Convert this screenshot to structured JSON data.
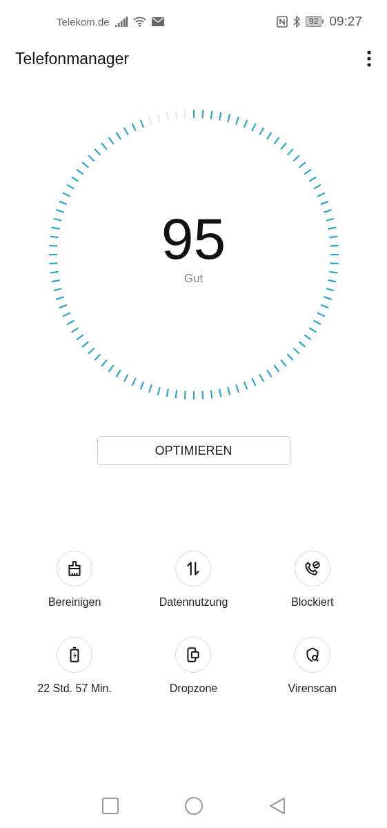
{
  "status_bar": {
    "carrier": "Telekom.de",
    "battery": "92",
    "time": "09:27"
  },
  "app_bar": {
    "title": "Telefonmanager"
  },
  "score": {
    "value": "95",
    "rating": "Gut"
  },
  "optimize_button": {
    "label": "OPTIMIEREN"
  },
  "tools": [
    {
      "kind": "clean",
      "label": "Bereinigen"
    },
    {
      "kind": "data",
      "label": "Datennutzung"
    },
    {
      "kind": "blocked",
      "label": "Blockiert"
    },
    {
      "kind": "battery",
      "label": "22 Std. 57 Min."
    },
    {
      "kind": "dropzone",
      "label": "Dropzone"
    },
    {
      "kind": "virus",
      "label": "Virenscan"
    }
  ]
}
